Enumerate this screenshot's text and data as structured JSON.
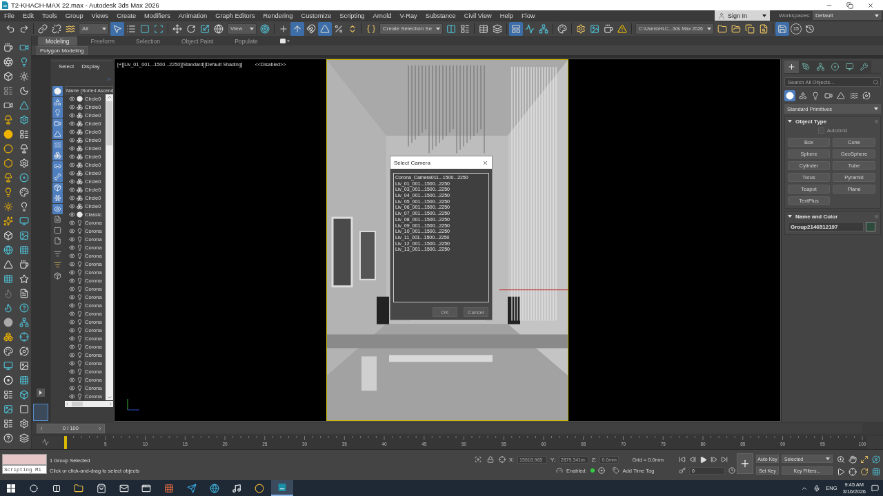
{
  "window": {
    "title": "T2-KHACH-MAX 22.max - Autodesk 3ds Max 2026"
  },
  "menu_bar": {
    "items": [
      "File",
      "Edit",
      "Tools",
      "Group",
      "Views",
      "Create",
      "Modifiers",
      "Animation",
      "Graph Editors",
      "Rendering",
      "Customize",
      "Scripting",
      "Arnold",
      "V-Ray",
      "Substance",
      "Civil View",
      "Help",
      "Flow"
    ],
    "sign_in": "Sign In",
    "workspaces_label": "Workspaces:",
    "workspace": "Default"
  },
  "main_toolbar": {
    "items": [
      {
        "kind": "undo",
        "on": false
      },
      {
        "kind": "redo",
        "on": false
      },
      {
        "kind": "link",
        "on": false
      },
      {
        "kind": "unlink",
        "on": false
      },
      {
        "kind": "bind_space_warp",
        "on": false
      },
      {
        "kind": "selection_filter",
        "value": "All"
      },
      {
        "kind": "select_object",
        "on": true
      },
      {
        "kind": "select_by_name",
        "on": false
      },
      {
        "kind": "region_select",
        "on": false
      },
      {
        "kind": "window_crossing",
        "on": false
      },
      {
        "kind": "move",
        "on": false
      },
      {
        "kind": "rotate",
        "on": false
      },
      {
        "kind": "scale",
        "on": false
      },
      {
        "kind": "placement",
        "on": false
      },
      {
        "kind": "reference_coordinate",
        "value": "View"
      },
      {
        "kind": "pivot_center",
        "on": false
      },
      {
        "kind": "manipulate",
        "on": false
      },
      {
        "kind": "keyboard_override",
        "on": true
      },
      {
        "kind": "snaps",
        "on": false
      },
      {
        "kind": "angle_snap",
        "on": true
      },
      {
        "kind": "percent_snap",
        "on": false
      },
      {
        "kind": "spinner_snap",
        "on": false
      },
      {
        "kind": "named_selection_sets",
        "on": false
      },
      {
        "kind": "selection_set",
        "value": "Create Selection Se"
      },
      {
        "kind": "mirror",
        "on": false
      },
      {
        "kind": "align",
        "on": false
      },
      {
        "kind": "scene_explorer",
        "on": false
      },
      {
        "kind": "layer_explorer",
        "on": false
      },
      {
        "kind": "ribbon",
        "on": true
      },
      {
        "kind": "curve_editor",
        "on": false
      },
      {
        "kind": "schematic_view",
        "on": false
      },
      {
        "kind": "material_editor",
        "on": false
      },
      {
        "kind": "render_setup",
        "on": false
      },
      {
        "kind": "rendered_frame",
        "on": false
      },
      {
        "kind": "render",
        "on": false
      },
      {
        "kind": "warnings",
        "on": false
      },
      {
        "kind": "project_folder",
        "value": "C:\\Users\\HLC...3ds Max 2026"
      },
      {
        "kind": "project_new",
        "on": false
      },
      {
        "kind": "project_open",
        "on": false
      },
      {
        "kind": "project_copy",
        "on": false
      },
      {
        "kind": "project_search",
        "on": false
      },
      {
        "kind": "autobackup",
        "on": true
      },
      {
        "kind": "autobackup_interval",
        "label": "15"
      },
      {
        "kind": "autobackup_restore",
        "on": false
      }
    ]
  },
  "ribbon": {
    "tabs": [
      {
        "label": "Modeling",
        "selected": true
      },
      {
        "label": "Freeform",
        "selected": false
      },
      {
        "label": "Selection",
        "selected": false
      },
      {
        "label": "Object Paint",
        "selected": false
      },
      {
        "label": "Populate",
        "selected": false
      }
    ],
    "panel": "Polygon Modeling"
  },
  "scene_explorer": {
    "menus": [
      "Select",
      "Display"
    ],
    "column": "Name (Sorted Ascend",
    "filters": [
      {
        "kind": "geometry",
        "on": true
      },
      {
        "kind": "shapes",
        "on": true
      },
      {
        "kind": "lights",
        "on": true
      },
      {
        "kind": "cameras",
        "on": true
      },
      {
        "kind": "helpers",
        "on": true
      },
      {
        "kind": "space_warps",
        "on": true
      },
      {
        "kind": "groups",
        "on": true
      },
      {
        "kind": "xrefs",
        "on": true
      },
      {
        "kind": "bones",
        "on": true
      },
      {
        "kind": "containers",
        "on": true
      },
      {
        "kind": "frozen",
        "on": true
      },
      {
        "kind": "hidden",
        "on": true
      },
      {
        "kind": "children",
        "on": false
      },
      {
        "kind": "influences",
        "on": false
      },
      {
        "kind": "dependents",
        "on": false
      }
    ],
    "rows": [
      {
        "name": "Circle0",
        "kind": "geometry",
        "selected": false
      },
      {
        "name": "Circle0",
        "kind": "group",
        "selected": false
      },
      {
        "name": "Circle0",
        "kind": "group",
        "selected": false
      },
      {
        "name": "Circle0",
        "kind": "group",
        "selected": false
      },
      {
        "name": "Circle0",
        "kind": "group",
        "selected": false
      },
      {
        "name": "Circle0",
        "kind": "group",
        "selected": false
      },
      {
        "name": "Circle0",
        "kind": "group",
        "selected": false
      },
      {
        "name": "Circle0",
        "kind": "group",
        "selected": false
      },
      {
        "name": "Circle0",
        "kind": "group",
        "selected": false
      },
      {
        "name": "Circle0",
        "kind": "group",
        "selected": false
      },
      {
        "name": "Circle0",
        "kind": "group",
        "selected": false
      },
      {
        "name": "Circle0",
        "kind": "group",
        "selected": false
      },
      {
        "name": "Circle0",
        "kind": "group",
        "selected": false
      },
      {
        "name": "Circle0",
        "kind": "group",
        "selected": false
      },
      {
        "name": "Classic",
        "kind": "geometry",
        "selected": false
      },
      {
        "name": "Corona",
        "kind": "light",
        "selected": false
      },
      {
        "name": "Corona",
        "kind": "light",
        "selected": false
      },
      {
        "name": "Corona",
        "kind": "light",
        "selected": false
      },
      {
        "name": "Corona",
        "kind": "light",
        "selected": false
      },
      {
        "name": "Corona",
        "kind": "light",
        "selected": false
      },
      {
        "name": "Corona",
        "kind": "light",
        "selected": false
      },
      {
        "name": "Corona",
        "kind": "light",
        "selected": false
      },
      {
        "name": "Corona",
        "kind": "light",
        "selected": false
      },
      {
        "name": "Corona",
        "kind": "light",
        "selected": false
      },
      {
        "name": "Corona",
        "kind": "light",
        "selected": false
      },
      {
        "name": "Corona",
        "kind": "light",
        "selected": false
      },
      {
        "name": "Corona",
        "kind": "light",
        "selected": false
      },
      {
        "name": "Corona",
        "kind": "light",
        "selected": false
      },
      {
        "name": "Corona",
        "kind": "light",
        "selected": false
      },
      {
        "name": "Corona",
        "kind": "light",
        "selected": false
      },
      {
        "name": "Corona",
        "kind": "light",
        "selected": false
      },
      {
        "name": "Corona",
        "kind": "light",
        "selected": false
      },
      {
        "name": "Corona",
        "kind": "light",
        "selected": false
      },
      {
        "name": "Corona",
        "kind": "light",
        "selected": false
      },
      {
        "name": "Corona",
        "kind": "light",
        "selected": false
      },
      {
        "name": "Corona",
        "kind": "light",
        "selected": false
      },
      {
        "name": "Corona",
        "kind": "light",
        "selected": false
      }
    ]
  },
  "viewport": {
    "label": "[+][Liv_01_001...1500...2250][Standard][Default Shading]",
    "status": "<<Disabled>>"
  },
  "select_camera_dialog": {
    "title": "Select Camera",
    "cameras": [
      {
        "name": "Corona_Camera011...1500...2250",
        "selected": false
      },
      {
        "name": "Liv_01_001...1500...2250",
        "selected": false
      },
      {
        "name": "Liv_03_001...1500...2250",
        "selected": false
      },
      {
        "name": "Liv_04_001...1500...2250",
        "selected": false
      },
      {
        "name": "Liv_05_001...1500...2250",
        "selected": false
      },
      {
        "name": "Liv_06_001...1500...2250",
        "selected": false
      },
      {
        "name": "Liv_07_001...1500...2250",
        "selected": false
      },
      {
        "name": "Liv_08_001...1500...2250",
        "selected": false
      },
      {
        "name": "Liv_09_001...1500...2250",
        "selected": false
      },
      {
        "name": "Liv_10_001...1500...2250",
        "selected": false
      },
      {
        "name": "Liv_11_001...1500...2250",
        "selected": false
      },
      {
        "name": "Liv_12_001...1500...2250",
        "selected": false
      },
      {
        "name": "Liv_13_001...1500...2250",
        "selected": false
      }
    ],
    "buttons": [
      "OK",
      "Cancel"
    ]
  },
  "command_panel": {
    "tabs": [
      {
        "kind": "create",
        "selected": true
      },
      {
        "kind": "modify",
        "selected": false
      },
      {
        "kind": "hierarchy",
        "selected": false
      },
      {
        "kind": "motion",
        "selected": false
      },
      {
        "kind": "display",
        "selected": false
      },
      {
        "kind": "utilities",
        "selected": false
      }
    ],
    "search": {
      "placeholder": "Search All Objects..."
    },
    "categories": [
      {
        "kind": "geometry",
        "selected": true
      },
      {
        "kind": "shapes",
        "selected": false
      },
      {
        "kind": "lights",
        "selected": false
      },
      {
        "kind": "cameras",
        "selected": false
      },
      {
        "kind": "helpers",
        "selected": false
      },
      {
        "kind": "space_warps",
        "selected": false
      },
      {
        "kind": "systems",
        "selected": false
      }
    ],
    "type_dropdown": "Standard Primitives",
    "object_type": {
      "title": "Object Type",
      "expanded": true,
      "autogrid": {
        "label": "AutoGrid",
        "checked": false,
        "disabled": true
      },
      "buttons": [
        "Box",
        "Cone",
        "Sphere",
        "GeoSphere",
        "Cylinder",
        "Tube",
        "Torus",
        "Pyramid",
        "Teapot",
        "Plane",
        "TextPlus"
      ]
    },
    "name_and_color": {
      "title": "Name and Color",
      "expanded": true,
      "name": "Group2146512197"
    }
  },
  "timeline": {
    "slider": {
      "frame": "0 / 100",
      "level": 0
    },
    "ticks": [
      "5",
      "10",
      "15",
      "20",
      "25",
      "30",
      "35",
      "40",
      "45",
      "50",
      "55",
      "60",
      "65",
      "70",
      "75",
      "80",
      "85",
      "90",
      "95",
      "100"
    ]
  },
  "status_bar": {
    "listener": "Scripting Mi",
    "prompt": "1 Group Selected",
    "hint": "Click or click-and-drag to select objects",
    "coordinates": [
      {
        "axis": "X:",
        "value": "15518.965",
        "disabled": true
      },
      {
        "axis": "Y:",
        "value": "2879.341m",
        "disabled": true
      },
      {
        "axis": "Z:",
        "value": "0.0mm",
        "disabled": true
      }
    ],
    "grid": "Grid = 0.0mm",
    "adaptive_degradation": {
      "label": "Enabled:",
      "on": true
    },
    "time_tag": "Add Time Tag",
    "frame": "0",
    "auto_key": "Auto Key",
    "key_mode": "Selected",
    "set_key": "Set Key",
    "key_filters": "Key Filters..."
  },
  "taskbar": {
    "apps": [
      {
        "kind": "folder",
        "selected": false
      },
      {
        "kind": "bag",
        "selected": false
      },
      {
        "kind": "mail",
        "selected": false
      },
      {
        "kind": "window",
        "selected": false
      },
      {
        "kind": "grid",
        "selected": false
      },
      {
        "kind": "plane",
        "selected": false
      },
      {
        "kind": "globe",
        "selected": false
      },
      {
        "kind": "note",
        "selected": false
      },
      {
        "kind": "ring",
        "selected": false
      },
      {
        "kind": "app",
        "selected": true
      }
    ],
    "language": "ENG",
    "time": "9:45 AM",
    "date": "3/16/2026"
  }
}
